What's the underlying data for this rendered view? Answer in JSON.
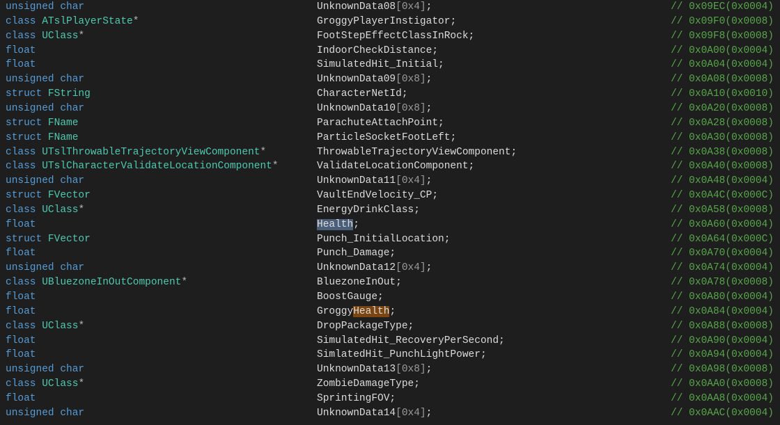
{
  "colors": {
    "background": "#1e1e1e",
    "keyword": "#569cd6",
    "type": "#4ec9b0",
    "comment": "#57a64a",
    "highlight_selected": "#4b5f7a",
    "highlight_match": "#7a4510"
  },
  "rows": [
    {
      "kw": "unsigned char",
      "type": "",
      "ptr": "",
      "name": "UnknownData08",
      "arr": "[0x4]",
      "comment": "// 0x09EC(0x0004)"
    },
    {
      "kw": "class",
      "type": "ATslPlayerState",
      "ptr": "*",
      "name": "GroggyPlayerInstigator",
      "arr": "",
      "comment": "// 0x09F0(0x0008)"
    },
    {
      "kw": "class",
      "type": "UClass",
      "ptr": "*",
      "name": "FootStepEffectClassInRock",
      "arr": "",
      "comment": "// 0x09F8(0x0008)"
    },
    {
      "kw": "float",
      "type": "",
      "ptr": "",
      "name": "IndoorCheckDistance",
      "arr": "",
      "comment": "// 0x0A00(0x0004)"
    },
    {
      "kw": "float",
      "type": "",
      "ptr": "",
      "name": "SimulatedHit_Initial",
      "arr": "",
      "comment": "// 0x0A04(0x0004)"
    },
    {
      "kw": "unsigned char",
      "type": "",
      "ptr": "",
      "name": "UnknownData09",
      "arr": "[0x8]",
      "comment": "// 0x0A08(0x0008)"
    },
    {
      "kw": "struct",
      "type": "FString",
      "ptr": "",
      "name": "CharacterNetId",
      "arr": "",
      "comment": "// 0x0A10(0x0010)"
    },
    {
      "kw": "unsigned char",
      "type": "",
      "ptr": "",
      "name": "UnknownData10",
      "arr": "[0x8]",
      "comment": "// 0x0A20(0x0008)"
    },
    {
      "kw": "struct",
      "type": "FName",
      "ptr": "",
      "name": "ParachuteAttachPoint",
      "arr": "",
      "comment": "// 0x0A28(0x0008)"
    },
    {
      "kw": "struct",
      "type": "FName",
      "ptr": "",
      "name": "ParticleSocketFootLeft",
      "arr": "",
      "comment": "// 0x0A30(0x0008)"
    },
    {
      "kw": "class",
      "type": "UTslThrowableTrajectoryViewComponent",
      "ptr": "*",
      "name": "ThrowableTrajectoryViewComponent",
      "arr": "",
      "comment": "// 0x0A38(0x0008)"
    },
    {
      "kw": "class",
      "type": "UTslCharacterValidateLocationComponent",
      "ptr": "*",
      "name": "ValidateLocationComponent",
      "arr": "",
      "comment": "// 0x0A40(0x0008)"
    },
    {
      "kw": "unsigned char",
      "type": "",
      "ptr": "",
      "name": "UnknownData11",
      "arr": "[0x4]",
      "comment": "// 0x0A48(0x0004)"
    },
    {
      "kw": "struct",
      "type": "FVector",
      "ptr": "",
      "name": "VaultEndVelocity_CP",
      "arr": "",
      "comment": "// 0x0A4C(0x000C)"
    },
    {
      "kw": "class",
      "type": "UClass",
      "ptr": "*",
      "name": "EnergyDrinkClass",
      "arr": "",
      "comment": "// 0x0A58(0x0008)"
    },
    {
      "kw": "float",
      "type": "",
      "ptr": "",
      "name_pre": "",
      "name_hl": "Health",
      "hl": "blue",
      "name": "",
      "arr": "",
      "comment": "// 0x0A60(0x0004)"
    },
    {
      "kw": "struct",
      "type": "FVector",
      "ptr": "",
      "name": "Punch_InitialLocation",
      "arr": "",
      "comment": "// 0x0A64(0x000C)"
    },
    {
      "kw": "float",
      "type": "",
      "ptr": "",
      "name": "Punch_Damage",
      "arr": "",
      "comment": "// 0x0A70(0x0004)"
    },
    {
      "kw": "unsigned char",
      "type": "",
      "ptr": "",
      "name": "UnknownData12",
      "arr": "[0x4]",
      "comment": "// 0x0A74(0x0004)"
    },
    {
      "kw": "class",
      "type": "UBluezoneInOutComponent",
      "ptr": "*",
      "name": "BluezoneInOut",
      "arr": "",
      "comment": "// 0x0A78(0x0008)"
    },
    {
      "kw": "float",
      "type": "",
      "ptr": "",
      "name": "BoostGauge",
      "arr": "",
      "comment": "// 0x0A80(0x0004)"
    },
    {
      "kw": "float",
      "type": "",
      "ptr": "",
      "name_pre": "Groggy",
      "name_hl": "Health",
      "hl": "orange",
      "name": "",
      "arr": "",
      "comment": "// 0x0A84(0x0004)"
    },
    {
      "kw": "class",
      "type": "UClass",
      "ptr": "*",
      "name": "DropPackageType",
      "arr": "",
      "comment": "// 0x0A88(0x0008)"
    },
    {
      "kw": "float",
      "type": "",
      "ptr": "",
      "name": "SimulatedHit_RecoveryPerSecond",
      "arr": "",
      "comment": "// 0x0A90(0x0004)"
    },
    {
      "kw": "float",
      "type": "",
      "ptr": "",
      "name": "SimlatedHit_PunchLightPower",
      "arr": "",
      "comment": "// 0x0A94(0x0004)"
    },
    {
      "kw": "unsigned char",
      "type": "",
      "ptr": "",
      "name": "UnknownData13",
      "arr": "[0x8]",
      "comment": "// 0x0A98(0x0008)"
    },
    {
      "kw": "class",
      "type": "UClass",
      "ptr": "*",
      "name": "ZombieDamageType",
      "arr": "",
      "comment": "// 0x0AA0(0x0008)"
    },
    {
      "kw": "float",
      "type": "",
      "ptr": "",
      "name": "SprintingFOV",
      "arr": "",
      "comment": "// 0x0AA8(0x0004)"
    },
    {
      "kw": "unsigned char",
      "type": "",
      "ptr": "",
      "name": "UnknownData14",
      "arr": "[0x4]",
      "comment": "// 0x0AAC(0x0004)"
    }
  ],
  "semicolon": ";"
}
